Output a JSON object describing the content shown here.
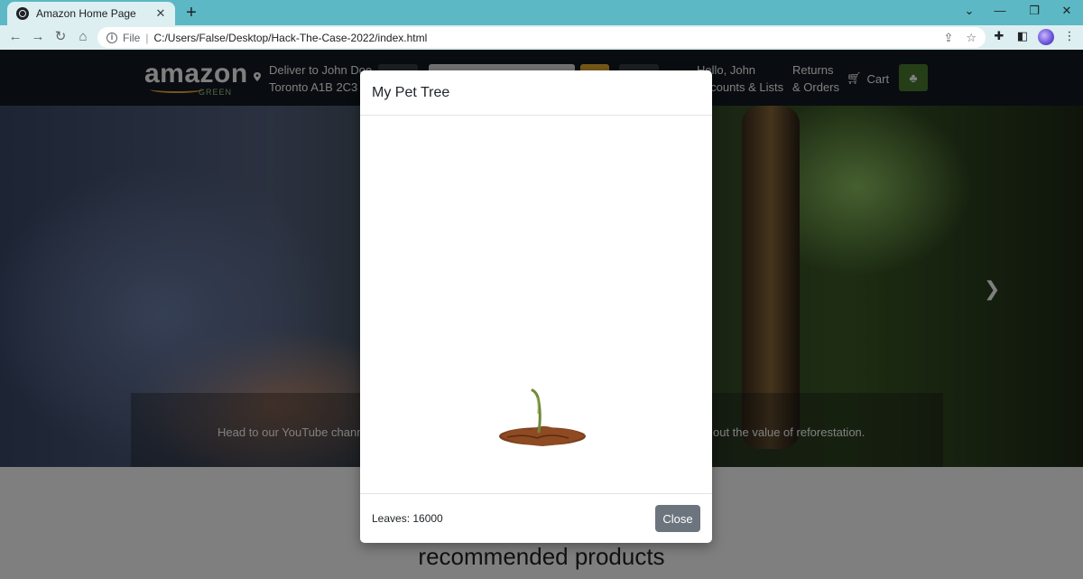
{
  "browser": {
    "tab_title": "Amazon Home Page",
    "tab_close": "✕",
    "new_tab": "+",
    "file_label": "File",
    "separator": "|",
    "url": "C:/Users/False/Desktop/Hack-The-Case-2022/index.html",
    "window_controls": {
      "collapse": "⌄",
      "minimize": "—",
      "restore": "❐",
      "close": "✕"
    }
  },
  "site": {
    "logo_word": "amazon",
    "logo_sub": "GREEN",
    "deliver_line1": "Deliver to John Doe",
    "deliver_line2": "Toronto A1B 2C3",
    "account_line1": "Hello, John",
    "account_line2": "Accounts & Lists",
    "returns_line1": "Returns",
    "returns_line2": "& Orders",
    "cart_label": "Cart",
    "hero_caption_left": "Head to our YouTube channel",
    "hero_caption_right": "out the value of reforestation.",
    "recommended_title": "recommended products"
  },
  "modal": {
    "title": "My Pet Tree",
    "leaves_text": "Leaves: 16000",
    "close_label": "Close"
  },
  "colors": {
    "tab_strip": "#5cb8c4",
    "toolbar": "#ddeff1",
    "nav_bg": "#131921",
    "tree_button": "#4a7d2e",
    "close_button": "#6c757d"
  }
}
